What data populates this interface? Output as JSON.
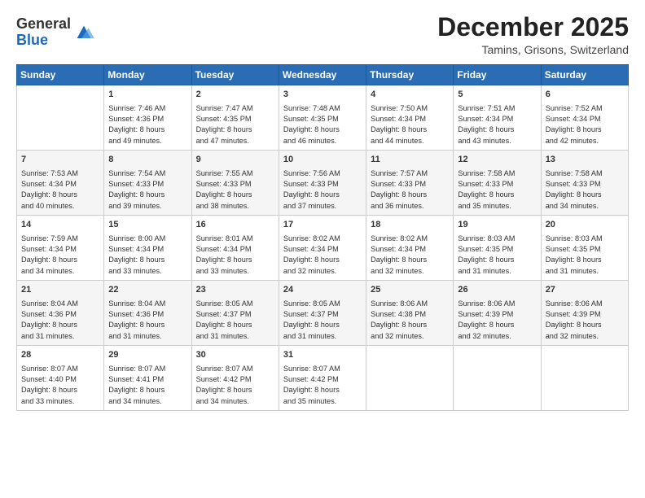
{
  "header": {
    "logo_general": "General",
    "logo_blue": "Blue",
    "month": "December 2025",
    "location": "Tamins, Grisons, Switzerland"
  },
  "days_of_week": [
    "Sunday",
    "Monday",
    "Tuesday",
    "Wednesday",
    "Thursday",
    "Friday",
    "Saturday"
  ],
  "weeks": [
    [
      {
        "day": "",
        "info": ""
      },
      {
        "day": "1",
        "info": "Sunrise: 7:46 AM\nSunset: 4:36 PM\nDaylight: 8 hours\nand 49 minutes."
      },
      {
        "day": "2",
        "info": "Sunrise: 7:47 AM\nSunset: 4:35 PM\nDaylight: 8 hours\nand 47 minutes."
      },
      {
        "day": "3",
        "info": "Sunrise: 7:48 AM\nSunset: 4:35 PM\nDaylight: 8 hours\nand 46 minutes."
      },
      {
        "day": "4",
        "info": "Sunrise: 7:50 AM\nSunset: 4:34 PM\nDaylight: 8 hours\nand 44 minutes."
      },
      {
        "day": "5",
        "info": "Sunrise: 7:51 AM\nSunset: 4:34 PM\nDaylight: 8 hours\nand 43 minutes."
      },
      {
        "day": "6",
        "info": "Sunrise: 7:52 AM\nSunset: 4:34 PM\nDaylight: 8 hours\nand 42 minutes."
      }
    ],
    [
      {
        "day": "7",
        "info": "Sunrise: 7:53 AM\nSunset: 4:34 PM\nDaylight: 8 hours\nand 40 minutes."
      },
      {
        "day": "8",
        "info": "Sunrise: 7:54 AM\nSunset: 4:33 PM\nDaylight: 8 hours\nand 39 minutes."
      },
      {
        "day": "9",
        "info": "Sunrise: 7:55 AM\nSunset: 4:33 PM\nDaylight: 8 hours\nand 38 minutes."
      },
      {
        "day": "10",
        "info": "Sunrise: 7:56 AM\nSunset: 4:33 PM\nDaylight: 8 hours\nand 37 minutes."
      },
      {
        "day": "11",
        "info": "Sunrise: 7:57 AM\nSunset: 4:33 PM\nDaylight: 8 hours\nand 36 minutes."
      },
      {
        "day": "12",
        "info": "Sunrise: 7:58 AM\nSunset: 4:33 PM\nDaylight: 8 hours\nand 35 minutes."
      },
      {
        "day": "13",
        "info": "Sunrise: 7:58 AM\nSunset: 4:33 PM\nDaylight: 8 hours\nand 34 minutes."
      }
    ],
    [
      {
        "day": "14",
        "info": "Sunrise: 7:59 AM\nSunset: 4:34 PM\nDaylight: 8 hours\nand 34 minutes."
      },
      {
        "day": "15",
        "info": "Sunrise: 8:00 AM\nSunset: 4:34 PM\nDaylight: 8 hours\nand 33 minutes."
      },
      {
        "day": "16",
        "info": "Sunrise: 8:01 AM\nSunset: 4:34 PM\nDaylight: 8 hours\nand 33 minutes."
      },
      {
        "day": "17",
        "info": "Sunrise: 8:02 AM\nSunset: 4:34 PM\nDaylight: 8 hours\nand 32 minutes."
      },
      {
        "day": "18",
        "info": "Sunrise: 8:02 AM\nSunset: 4:34 PM\nDaylight: 8 hours\nand 32 minutes."
      },
      {
        "day": "19",
        "info": "Sunrise: 8:03 AM\nSunset: 4:35 PM\nDaylight: 8 hours\nand 31 minutes."
      },
      {
        "day": "20",
        "info": "Sunrise: 8:03 AM\nSunset: 4:35 PM\nDaylight: 8 hours\nand 31 minutes."
      }
    ],
    [
      {
        "day": "21",
        "info": "Sunrise: 8:04 AM\nSunset: 4:36 PM\nDaylight: 8 hours\nand 31 minutes."
      },
      {
        "day": "22",
        "info": "Sunrise: 8:04 AM\nSunset: 4:36 PM\nDaylight: 8 hours\nand 31 minutes."
      },
      {
        "day": "23",
        "info": "Sunrise: 8:05 AM\nSunset: 4:37 PM\nDaylight: 8 hours\nand 31 minutes."
      },
      {
        "day": "24",
        "info": "Sunrise: 8:05 AM\nSunset: 4:37 PM\nDaylight: 8 hours\nand 31 minutes."
      },
      {
        "day": "25",
        "info": "Sunrise: 8:06 AM\nSunset: 4:38 PM\nDaylight: 8 hours\nand 32 minutes."
      },
      {
        "day": "26",
        "info": "Sunrise: 8:06 AM\nSunset: 4:39 PM\nDaylight: 8 hours\nand 32 minutes."
      },
      {
        "day": "27",
        "info": "Sunrise: 8:06 AM\nSunset: 4:39 PM\nDaylight: 8 hours\nand 32 minutes."
      }
    ],
    [
      {
        "day": "28",
        "info": "Sunrise: 8:07 AM\nSunset: 4:40 PM\nDaylight: 8 hours\nand 33 minutes."
      },
      {
        "day": "29",
        "info": "Sunrise: 8:07 AM\nSunset: 4:41 PM\nDaylight: 8 hours\nand 34 minutes."
      },
      {
        "day": "30",
        "info": "Sunrise: 8:07 AM\nSunset: 4:42 PM\nDaylight: 8 hours\nand 34 minutes."
      },
      {
        "day": "31",
        "info": "Sunrise: 8:07 AM\nSunset: 4:42 PM\nDaylight: 8 hours\nand 35 minutes."
      },
      {
        "day": "",
        "info": ""
      },
      {
        "day": "",
        "info": ""
      },
      {
        "day": "",
        "info": ""
      }
    ]
  ]
}
